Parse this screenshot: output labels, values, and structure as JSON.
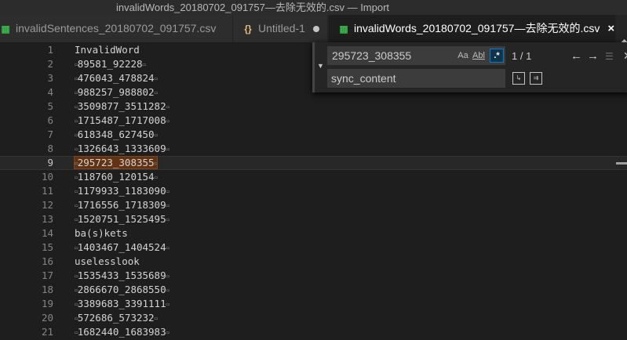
{
  "window": {
    "title": "invalidWords_20180702_091757—去除无效的.csv — Import"
  },
  "tabs": [
    {
      "label": "invalidSentences_20180702_091757.csv",
      "icon": "csv-file-icon",
      "active": false
    },
    {
      "label": "Untitled-1",
      "icon": "json-braces-icon",
      "active": false,
      "dirty": true
    },
    {
      "label": "invalidWords_20180702_091757—去除无效的.csv",
      "icon": "csv-file-icon",
      "active": true
    }
  ],
  "find": {
    "search_value": "295723_308355",
    "replace_value": "sync_content",
    "match_case_label": "Aa",
    "whole_word_label": "Abl",
    "regex_label": ".*",
    "match_count": "1 / 1",
    "regex_enabled": true
  },
  "editor": {
    "current_line": 9,
    "lines": [
      {
        "num": "1",
        "bom": false,
        "text": "InvalidWord"
      },
      {
        "num": "2",
        "bom": true,
        "text": "89581_92228"
      },
      {
        "num": "3",
        "bom": true,
        "text": "476043_478824"
      },
      {
        "num": "4",
        "bom": true,
        "text": "988257_988802"
      },
      {
        "num": "5",
        "bom": true,
        "text": "3509877_3511282"
      },
      {
        "num": "6",
        "bom": true,
        "text": "1715487_1717008"
      },
      {
        "num": "7",
        "bom": true,
        "text": "618348_627450"
      },
      {
        "num": "8",
        "bom": true,
        "text": "1326643_1333609"
      },
      {
        "num": "9",
        "bom": true,
        "text": "295723_308355",
        "highlight": true
      },
      {
        "num": "10",
        "bom": true,
        "text": "118760_120154"
      },
      {
        "num": "11",
        "bom": true,
        "text": "1179933_1183090"
      },
      {
        "num": "12",
        "bom": true,
        "text": "1716556_1718309"
      },
      {
        "num": "13",
        "bom": true,
        "text": "1520751_1525495"
      },
      {
        "num": "14",
        "bom": false,
        "text": "ba(s)kets"
      },
      {
        "num": "15",
        "bom": true,
        "text": "1403467_1404524"
      },
      {
        "num": "16",
        "bom": false,
        "text": "uselesslook"
      },
      {
        "num": "17",
        "bom": true,
        "text": "1535433_1535689"
      },
      {
        "num": "18",
        "bom": true,
        "text": "2866670_2868550"
      },
      {
        "num": "19",
        "bom": true,
        "text": "3389683_3391111"
      },
      {
        "num": "20",
        "bom": true,
        "text": "572686_573232"
      },
      {
        "num": "21",
        "bom": true,
        "text": "1682440_1683983"
      }
    ],
    "bom_glyph": "ZWNBSP"
  },
  "colors": {
    "accent": "#007acc",
    "match_highlight": "#613214",
    "background": "#1e1e1e"
  }
}
